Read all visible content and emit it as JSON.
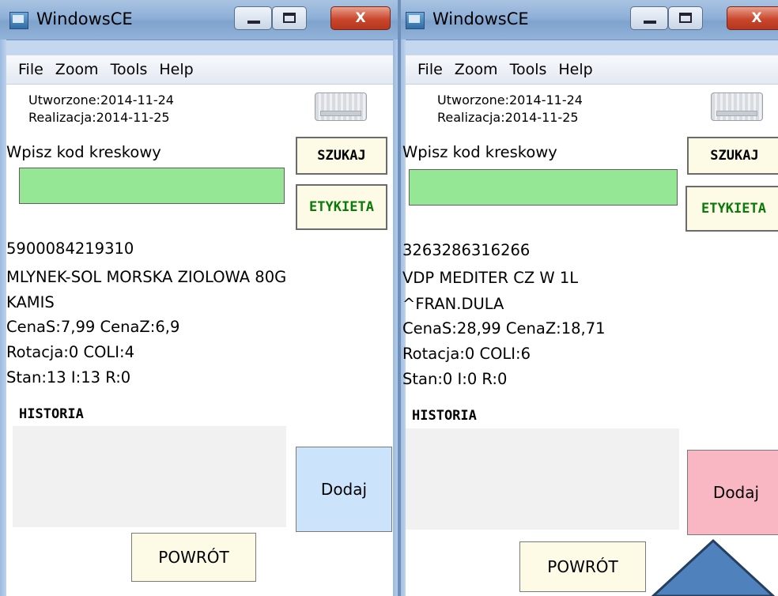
{
  "windows": [
    {
      "title": "WindowsCE",
      "close_glyph": "X",
      "menu": [
        "File",
        "Zoom",
        "Tools",
        "Help"
      ],
      "created": "Utworzone:2014-11-24",
      "realization": "Realizacja:2014-11-25",
      "barcode_prompt": "Wpisz kod kreskowy",
      "barcode_value": "",
      "search_label": "SZUKAJ",
      "label_button": "ETYKIETA",
      "product": {
        "ean": "5900084219310",
        "name": "MLYNEK-SOL MORSKA ZIOLOWA 80G",
        "supplier": "KAMIS",
        "prices": "CenaS:7,99   CenaZ:6,9",
        "rotation": "Rotacja:0   COLI:4",
        "stock": "Stan:13  I:13  R:0"
      },
      "history_label": "HISTORIA",
      "add_label": "Dodaj",
      "add_color": "#cce4fb",
      "back_label": "POWRÓT"
    },
    {
      "title": "WindowsCE",
      "close_glyph": "X",
      "menu": [
        "File",
        "Zoom",
        "Tools",
        "Help"
      ],
      "created": "Utworzone:2014-11-24",
      "realization": "Realizacja:2014-11-25",
      "barcode_prompt": "Wpisz kod kreskowy",
      "barcode_value": "",
      "search_label": "SZUKAJ",
      "label_button": "ETYKIETA",
      "product": {
        "ean": "3263286316266",
        "name": "VDP MEDITER CZ W 1L",
        "supplier": "^FRAN.DULA",
        "prices": "CenaS:28,99   CenaZ:18,71",
        "rotation": "Rotacja:0   COLI:6",
        "stock": "Stan:0  I:0  R:0"
      },
      "history_label": "HISTORIA",
      "add_label": "Dodaj",
      "add_color": "#f8b7c3",
      "back_label": "POWRÓT"
    }
  ],
  "overlay": {
    "shape": "up-arrow-triangle",
    "fill": "#4f81bd",
    "stroke": "#243f60"
  }
}
